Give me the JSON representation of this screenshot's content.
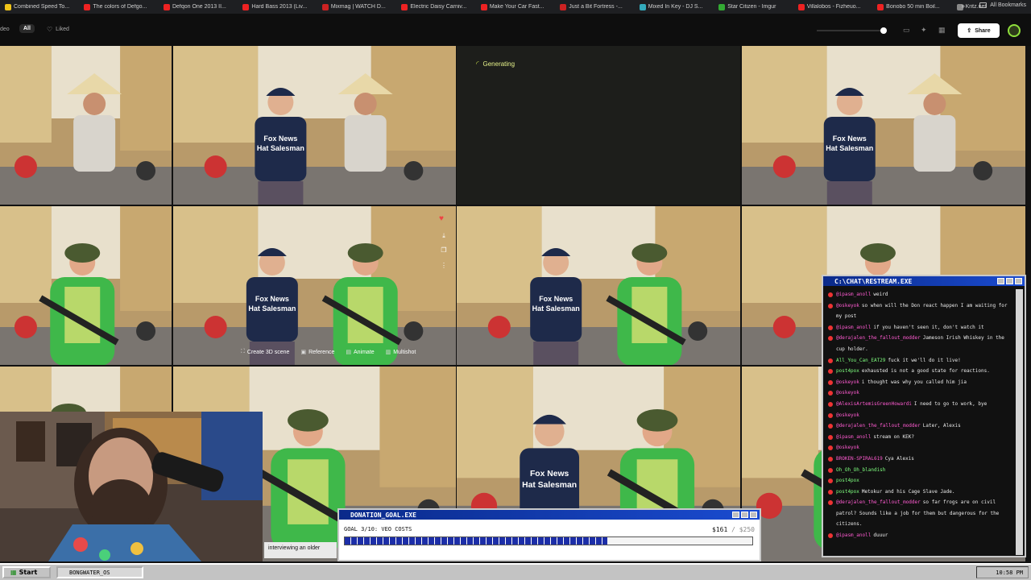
{
  "bookmarks": [
    {
      "label": "Combined Speed To...",
      "color": "#f0c419"
    },
    {
      "label": "The colors of Defgo...",
      "color": "#e22"
    },
    {
      "label": "Defqon One 2013 II...",
      "color": "#e22"
    },
    {
      "label": "Hard Bass 2013 (Liv...",
      "color": "#e22"
    },
    {
      "label": "Mixmag | WATCH D...",
      "color": "#c22"
    },
    {
      "label": "Electric Daisy Carniv...",
      "color": "#e22"
    },
    {
      "label": "Make Your Car Fast...",
      "color": "#e22"
    },
    {
      "label": "Just a Bit Fortress -...",
      "color": "#c22"
    },
    {
      "label": "Mixed In Key - DJ S...",
      "color": "#3ab"
    },
    {
      "label": "Star Citizen - Imgur",
      "color": "#3a3"
    },
    {
      "label": "Villalobos - Fizheuo...",
      "color": "#e22"
    },
    {
      "label": "Bonobo 50 min Boil...",
      "color": "#e22"
    },
    {
      "label": "Kritz.net",
      "color": "#888"
    }
  ],
  "bookmarks_more_icon": "double-chevron-icon",
  "bookmarks_all": "All Bookmarks",
  "toolbar": {
    "filter_partial": "deo",
    "filter_all": "All",
    "filter_liked": "Liked",
    "share": "Share"
  },
  "generating_label": "Generating",
  "tile_caption": "Fox News\nHat Salesman",
  "hover_tools": {
    "create_3d": "Create 3D scene",
    "reference": "Reference",
    "animate": "Animate",
    "multishot": "Multishot"
  },
  "chat": {
    "title": "C:\\CHAT\\RESTREAM.EXE",
    "messages": [
      {
        "name": "@ipasm_anoll",
        "text": "weird"
      },
      {
        "name": "@oskeyok",
        "text": "so when will the Don react happen I am waiting for my post"
      },
      {
        "name": "@ipasm_anoll",
        "text": "if you haven't seen it, don't watch it"
      },
      {
        "name": "@derajalen_the_fallout_modder",
        "text": "Jameson Irish Whiskey in the cup holder."
      },
      {
        "name": "All_You_Can_EAT29",
        "text": "fuck it we'll do it live!",
        "green": true
      },
      {
        "name": "post4pox",
        "text": "exhausted is not a good state for reactions.",
        "green": true
      },
      {
        "name": "@oskeyok",
        "text": "i thought was why you called him jia"
      },
      {
        "name": "@oskeyok",
        "text": ""
      },
      {
        "name": "@AlexisArtemisGreenHowardi",
        "text": "I need to go to work, bye"
      },
      {
        "name": "@oskeyok",
        "text": ""
      },
      {
        "name": "@derajalen_the_fallout_modder",
        "text": "Later, Alexis"
      },
      {
        "name": "@ipasm_anoll",
        "text": "stream on KEK?"
      },
      {
        "name": "@oskeyok",
        "text": ""
      },
      {
        "name": "BROKEN-SPIRAL619",
        "text": "Cya Alexis"
      },
      {
        "name": "Oh_Oh_Oh_blandish",
        "text": "",
        "green": true
      },
      {
        "name": "post4pox",
        "text": "",
        "green": true
      },
      {
        "name": "post4pox",
        "text": "Metokur and his Cage Slave Jade.",
        "green": true
      },
      {
        "name": "@derajalen_the_fallout_modder",
        "text": "so far frogs are on civil patrol? Sounds like a job for them but dangerous for the citizens."
      },
      {
        "name": "@ipasm_anoll",
        "text": "duuur"
      }
    ]
  },
  "donation": {
    "title": "DONATION_GOAL.EXE",
    "goal_text": "GOAL 3/10: VEO COSTS",
    "current": "$161",
    "target": "/ $250",
    "progress": 0.644
  },
  "caption": "interviewing an older",
  "taskbar": {
    "start": "Start",
    "window": "BONGWATER_OS",
    "clock": "10:58 PM"
  }
}
